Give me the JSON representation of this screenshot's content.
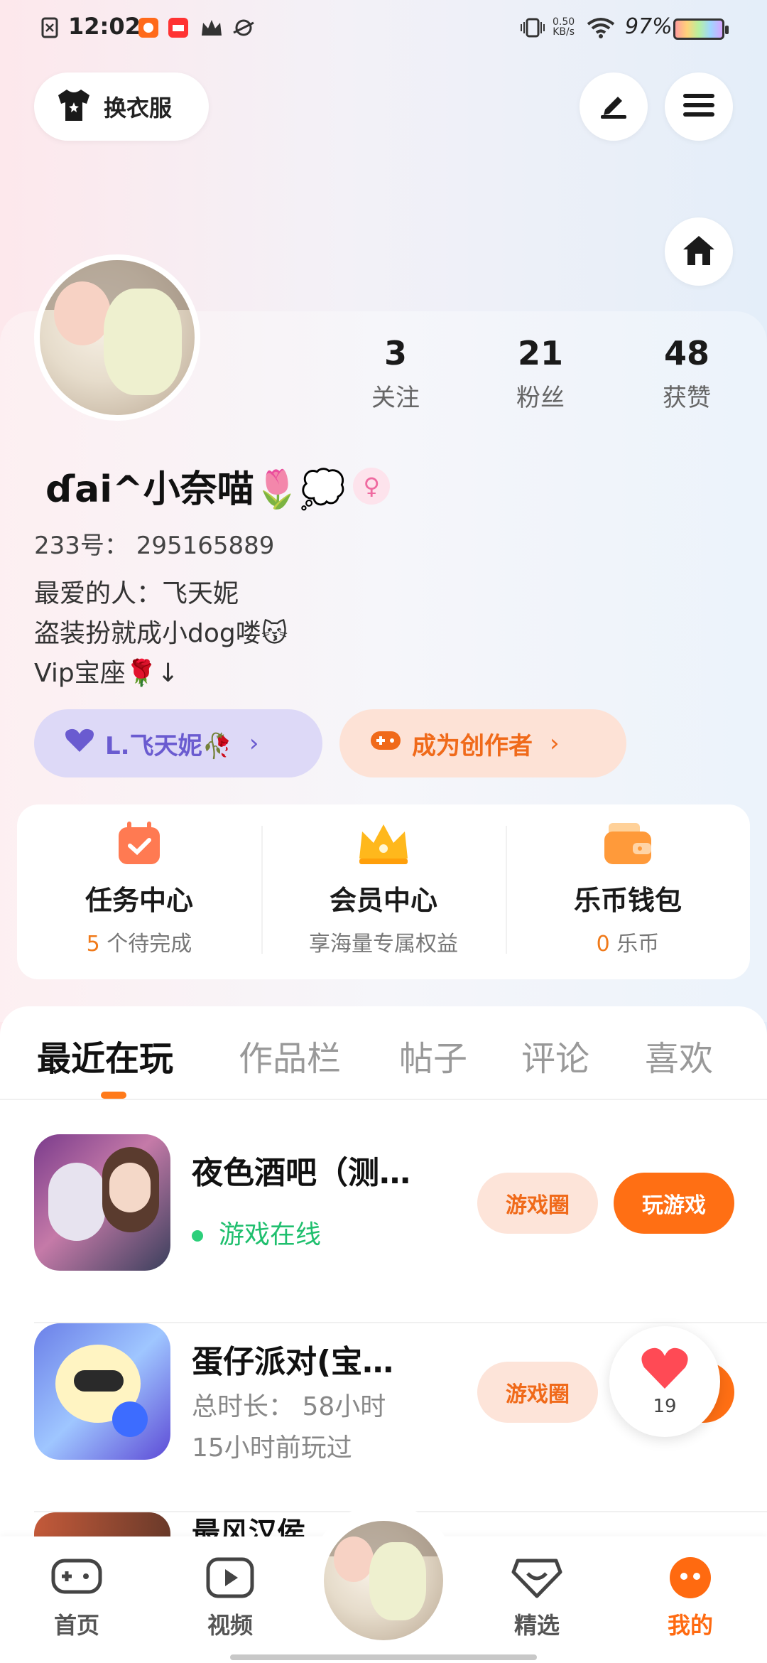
{
  "status_bar": {
    "time": "12:02",
    "speed": "0.50",
    "speed_unit": "KB/s",
    "battery": "97%"
  },
  "top_bar": {
    "dress_label": "换衣服"
  },
  "profile": {
    "stats": [
      {
        "value": "3",
        "label": "关注"
      },
      {
        "value": "21",
        "label": "粉丝"
      },
      {
        "value": "48",
        "label": "获赞"
      }
    ],
    "nickname": "ɗai^小奈喵🌷💭",
    "user_id": "233号：  295165889",
    "bio_lines": [
      "最爱的人：飞天妮",
      "盗装扮就成小dog喽😽",
      "Vip宝座🌹↓"
    ],
    "love_pill": "L.飞天妮🥀",
    "creator_pill": "成为创作者"
  },
  "quick": {
    "items": [
      {
        "title": "任务中心",
        "sub_hl": "5",
        "sub": " 个待完成"
      },
      {
        "title": "会员中心",
        "sub_hl": "",
        "sub": "享海量专属权益"
      },
      {
        "title": "乐币钱包",
        "sub_hl": "0",
        "sub": " 乐币"
      }
    ]
  },
  "tabs": [
    "最近在玩",
    "作品栏",
    "帖子",
    "评论",
    "喜欢"
  ],
  "games": [
    {
      "name": "夜色酒吧（测…",
      "status": "游戏在线",
      "circle_label": "游戏圈",
      "play_label": "玩游戏"
    },
    {
      "name": "蛋仔派对(宝…",
      "duration": "总时长：  58小时",
      "last_played": "15小时前玩过",
      "circle_label": "游戏圈"
    },
    {
      "name": "最风汉侯"
    }
  ],
  "like_bubble": {
    "count": "19"
  },
  "bottom_nav": {
    "items": [
      {
        "label": "首页"
      },
      {
        "label": "视频"
      },
      {
        "label": "精选"
      },
      {
        "label": "我的"
      }
    ]
  },
  "colors": {
    "accent": "#ff6f14",
    "online": "#1fbf6e",
    "love": "#6a5bd0"
  }
}
